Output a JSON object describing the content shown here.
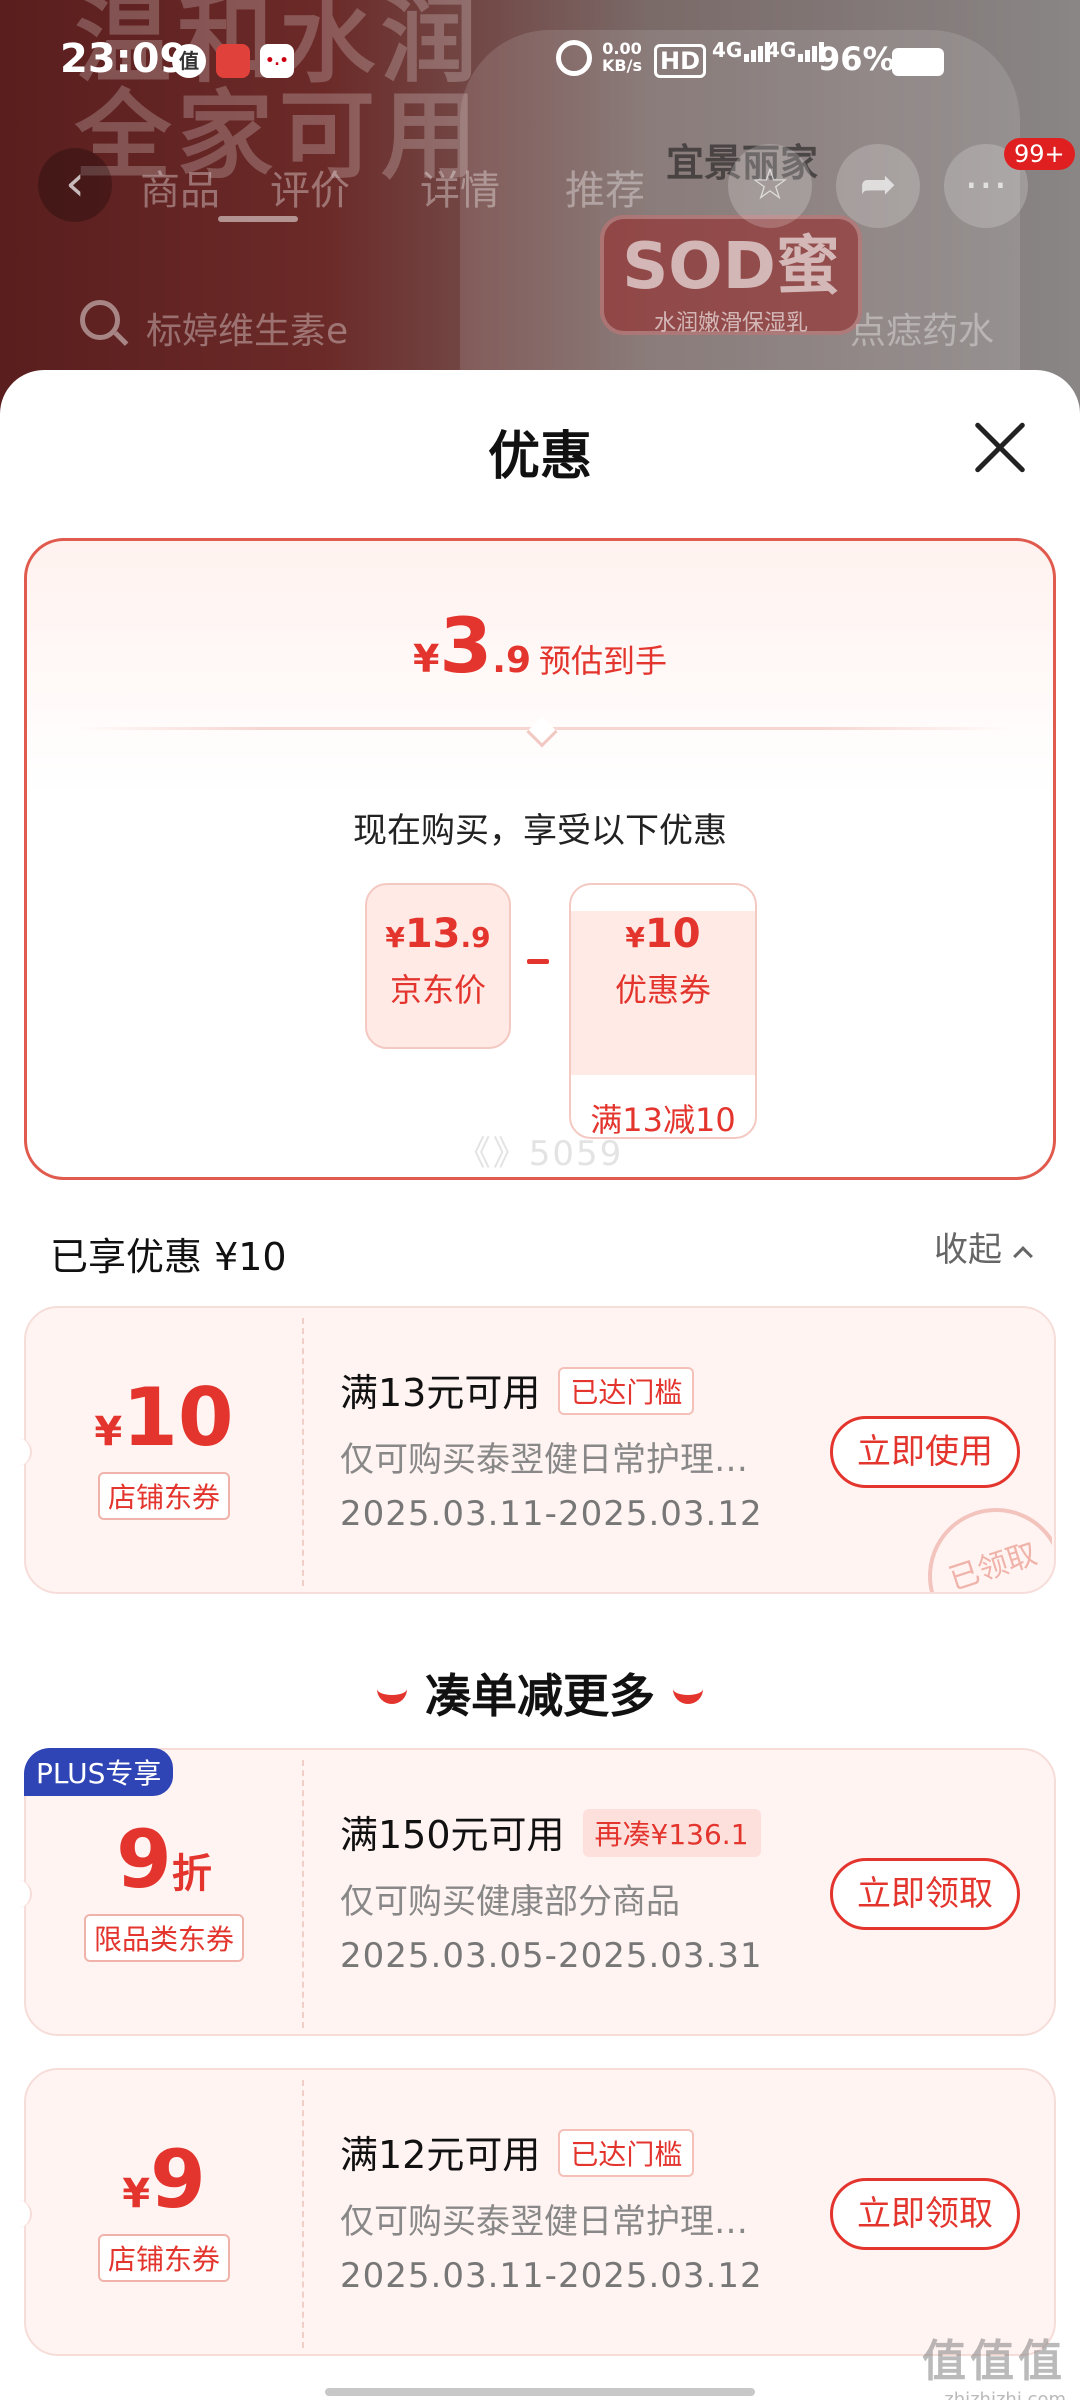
{
  "status_bar": {
    "time": "23:09",
    "app_icon_1": "值",
    "net_speed_value": "0.00",
    "net_speed_unit": "KB/s",
    "hd_label": "HD",
    "signal_1": "4G",
    "signal_2": "4G",
    "battery": "96%"
  },
  "background_page": {
    "ad_line_1": "温和水润",
    "ad_line_2": "全家可用",
    "brand": "宜景丽家",
    "product_name": "SOD蜜",
    "product_subtitle": "水润嫩滑保湿乳",
    "tabs": [
      "商品",
      "评价",
      "详情",
      "推荐"
    ],
    "cart_badge": "99+",
    "search_keyword": "标婷维生素e",
    "search_keyword_2": "点痣药水"
  },
  "sheet": {
    "title": "优惠",
    "summary": {
      "currency": "¥",
      "est_int": "3",
      "est_dec": ".9",
      "est_label": "预估到手",
      "now_buy_text": "现在购买，享受以下优惠",
      "jd_price_int": "13",
      "jd_price_dec": ".9",
      "jd_price_label": "京东价",
      "coupon_amount": "10",
      "coupon_label": "优惠券",
      "coupon_condition": "满13减10",
      "watermark": "《》5059"
    },
    "enjoyed_label": "已享优惠 ¥10",
    "collapse_label": "收起",
    "more_title": "凑单减更多",
    "coupons": [
      {
        "currency": "¥",
        "amount": "10",
        "unit": "",
        "type": "店铺东券",
        "condition": "满13元可用",
        "tag": "已达门槛",
        "scope": "仅可购买泰翌健日常护理…",
        "date": "2025.03.11-2025.03.12",
        "button": "立即使用",
        "stamp": "已领取"
      },
      {
        "badge": "PLUS专享",
        "currency": "",
        "amount": "9",
        "unit": "折",
        "type": "限品类东券",
        "condition": "满150元可用",
        "tag": "再凑¥136.1",
        "scope": "仅可购买健康部分商品",
        "date": "2025.03.05-2025.03.31",
        "button": "立即领取"
      },
      {
        "currency": "¥",
        "amount": "9",
        "unit": "",
        "type": "店铺东券",
        "condition": "满12元可用",
        "tag": "已达门槛",
        "scope": "仅可购买泰翌健日常护理…",
        "date": "2025.03.11-2025.03.12",
        "button": "立即领取"
      }
    ]
  },
  "site_watermark": {
    "glyphs": "值值值",
    "url": "zhizhizhi.com"
  },
  "colors": {
    "accent": "#e3352d",
    "plus_badge": "#2f44b5",
    "coupon_bg": "#fff4f2"
  }
}
